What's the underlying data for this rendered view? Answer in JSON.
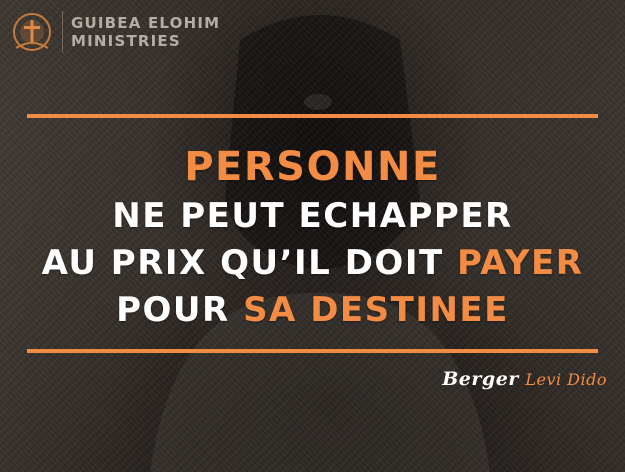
{
  "logo": {
    "line1": "GUIBEA ELOHIM",
    "line2": "MINISTRIES",
    "icon": "ministry-emblem-icon"
  },
  "quote": {
    "line1": "PERSONNE",
    "line2": "NE PEUT ECHAPPER",
    "line3_prefix": "AU PRIX QU’IL DOIT ",
    "line3_highlight": "PAYER",
    "line4_prefix": "POUR ",
    "line4_highlight": "SA DESTINEE"
  },
  "signature": {
    "title": "Berger",
    "name": "Levi Dido"
  },
  "colors": {
    "accent": "#f28b44",
    "text": "#ffffff",
    "logo_text": "#b7aca3"
  }
}
